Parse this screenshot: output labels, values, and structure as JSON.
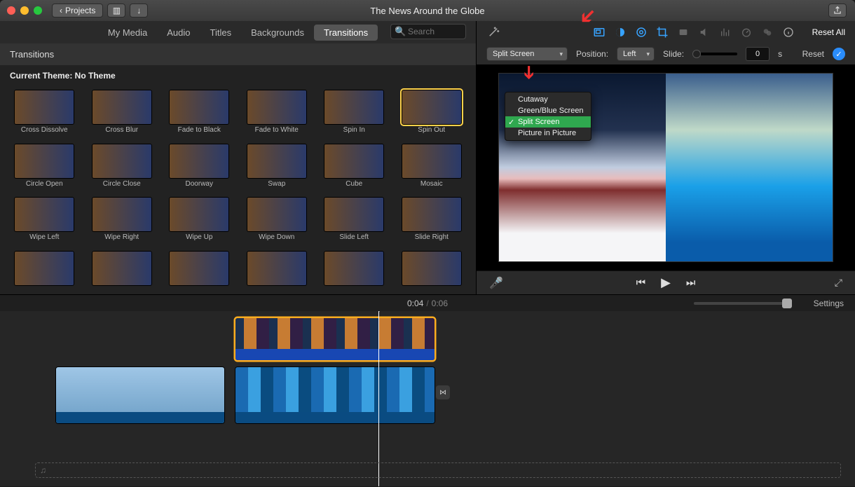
{
  "titlebar": {
    "projects_label": "Projects",
    "window_title": "The News Around the Globe"
  },
  "library": {
    "tabs": [
      "My Media",
      "Audio",
      "Titles",
      "Backgrounds",
      "Transitions"
    ],
    "active_tab": 4,
    "search_placeholder": "Search",
    "section_title": "Transitions",
    "theme_line": "Current Theme: No Theme",
    "transitions": [
      "Cross Dissolve",
      "Cross Blur",
      "Fade to Black",
      "Fade to White",
      "Spin In",
      "Spin Out",
      "Circle Open",
      "Circle Close",
      "Doorway",
      "Swap",
      "Cube",
      "Mosaic",
      "Wipe Left",
      "Wipe Right",
      "Wipe Up",
      "Wipe Down",
      "Slide Left",
      "Slide Right",
      "",
      "",
      "",
      "",
      "",
      ""
    ],
    "selected_index": 5
  },
  "inspector": {
    "reset_all": "Reset All",
    "overlay_select": "Split Screen",
    "position_label": "Position:",
    "position_value": "Left",
    "slide_label": "Slide:",
    "slide_value": "0",
    "slide_unit": "s",
    "reset_label": "Reset",
    "dropdown_items": [
      "Cutaway",
      "Green/Blue Screen",
      "Split Screen",
      "Picture in Picture"
    ],
    "dropdown_selected": 2
  },
  "transport": {
    "prev": "⏮",
    "play": "▶",
    "next": "⏭"
  },
  "timebar": {
    "current": "0:04",
    "total": "0:06",
    "settings": "Settings"
  },
  "timeline": {
    "audio_hint": "♫"
  }
}
